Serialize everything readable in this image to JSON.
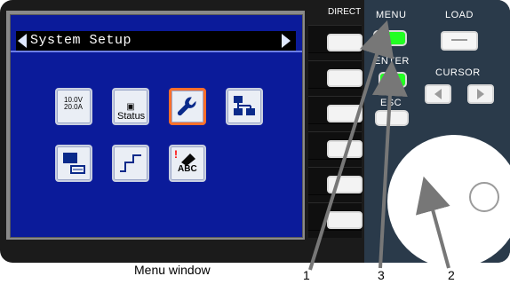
{
  "screen": {
    "title": "System Setup"
  },
  "icons": {
    "voltage_top": "10.0V",
    "voltage_bottom": "20.0A",
    "status_label": "Status",
    "abc_label": "ABC"
  },
  "panel": {
    "direct": "DIRECT",
    "menu": "MENU",
    "enter": "ENTER",
    "esc": "ESC",
    "load": "LOAD",
    "cursor": "CURSOR"
  },
  "caption": {
    "menu_window": "Menu window",
    "num1": "1",
    "num2": "2",
    "num3": "3"
  },
  "colors": {
    "screen_blue": "#0b1b9a",
    "highlight_orange": "#ff6f2a",
    "button_green": "#22ff22"
  }
}
